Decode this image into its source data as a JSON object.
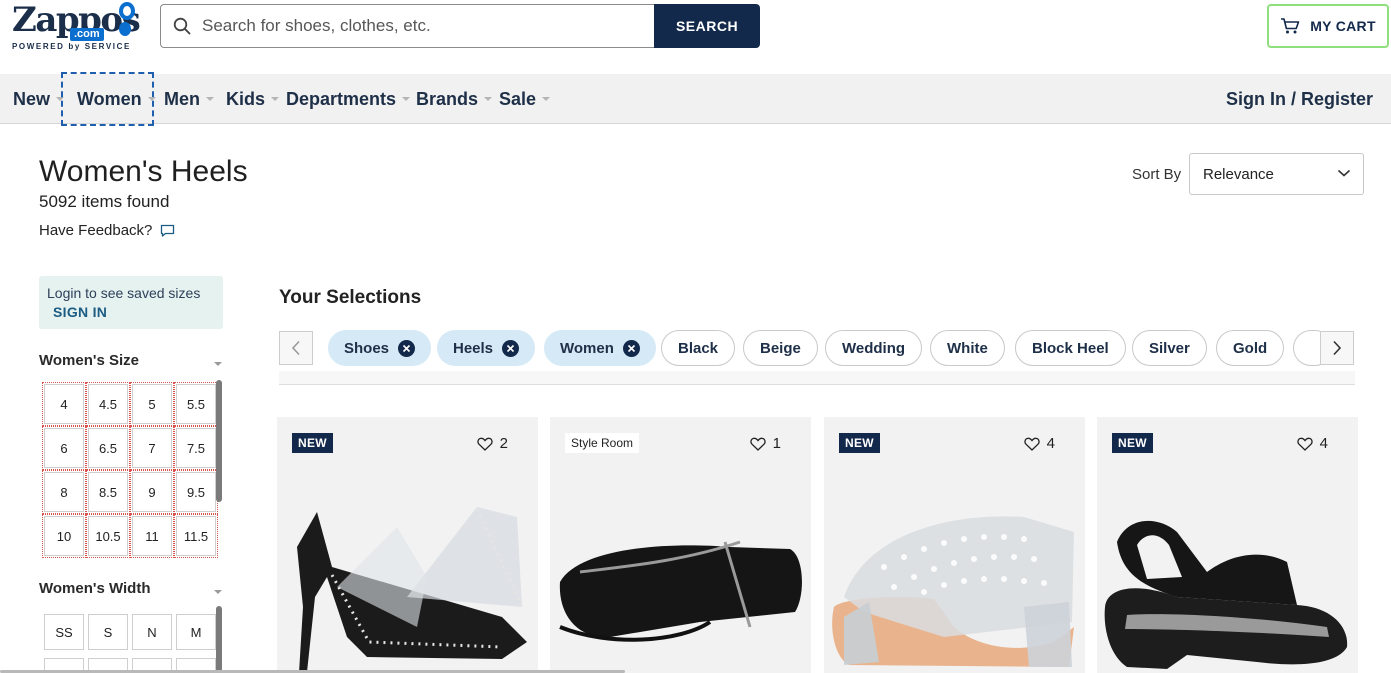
{
  "header": {
    "logo_word": "Zappos",
    "logo_com": ".com",
    "logo_tagline": "POWERED by SERVICE",
    "search_placeholder": "Search for shoes, clothes, etc.",
    "search_button": "SEARCH",
    "cart_label": "MY CART"
  },
  "nav": {
    "items": [
      "New",
      "Women",
      "Men",
      "Kids",
      "Departments",
      "Brands",
      "Sale"
    ],
    "focused_item": "Women",
    "sign_in": "Sign In / Register"
  },
  "page": {
    "title": "Women's Heels",
    "count": "5092 items found",
    "feedback": "Have Feedback?",
    "sort_label": "Sort By",
    "sort_value": "Relevance"
  },
  "sidebar": {
    "login_text": "Login to see saved sizes",
    "login_link": "SIGN IN",
    "size_title": "Women's Size",
    "sizes": [
      "4",
      "4.5",
      "5",
      "5.5",
      "6",
      "6.5",
      "7",
      "7.5",
      "8",
      "8.5",
      "9",
      "9.5",
      "10",
      "10.5",
      "11",
      "11.5"
    ],
    "width_title": "Women's Width",
    "widths": [
      "SS",
      "S",
      "N",
      "M"
    ]
  },
  "selections": {
    "title": "Your Selections",
    "active_chips": [
      "Shoes",
      "Heels",
      "Women"
    ],
    "suggested_chips": [
      "Black",
      "Beige",
      "Wedding",
      "White",
      "Block Heel",
      "Silver",
      "Gold"
    ]
  },
  "products": [
    {
      "badge": "NEW",
      "badge_type": "new",
      "favorites": "2",
      "image": "clear-studded-stiletto-pump"
    },
    {
      "badge": "Style Room",
      "badge_type": "style",
      "favorites": "1",
      "image": "black-strappy-flat-sandal"
    },
    {
      "badge": "NEW",
      "badge_type": "new",
      "favorites": "4",
      "image": "clear-studded-block-heel-mule"
    },
    {
      "badge": "NEW",
      "badge_type": "new",
      "favorites": "4",
      "image": "black-comfort-wedge-sandal"
    }
  ],
  "colors": {
    "navy": "#13294b",
    "chip_active_bg": "#d6e9f6",
    "cart_border": "#8ee07c",
    "login_bg": "#e6f2ef"
  }
}
